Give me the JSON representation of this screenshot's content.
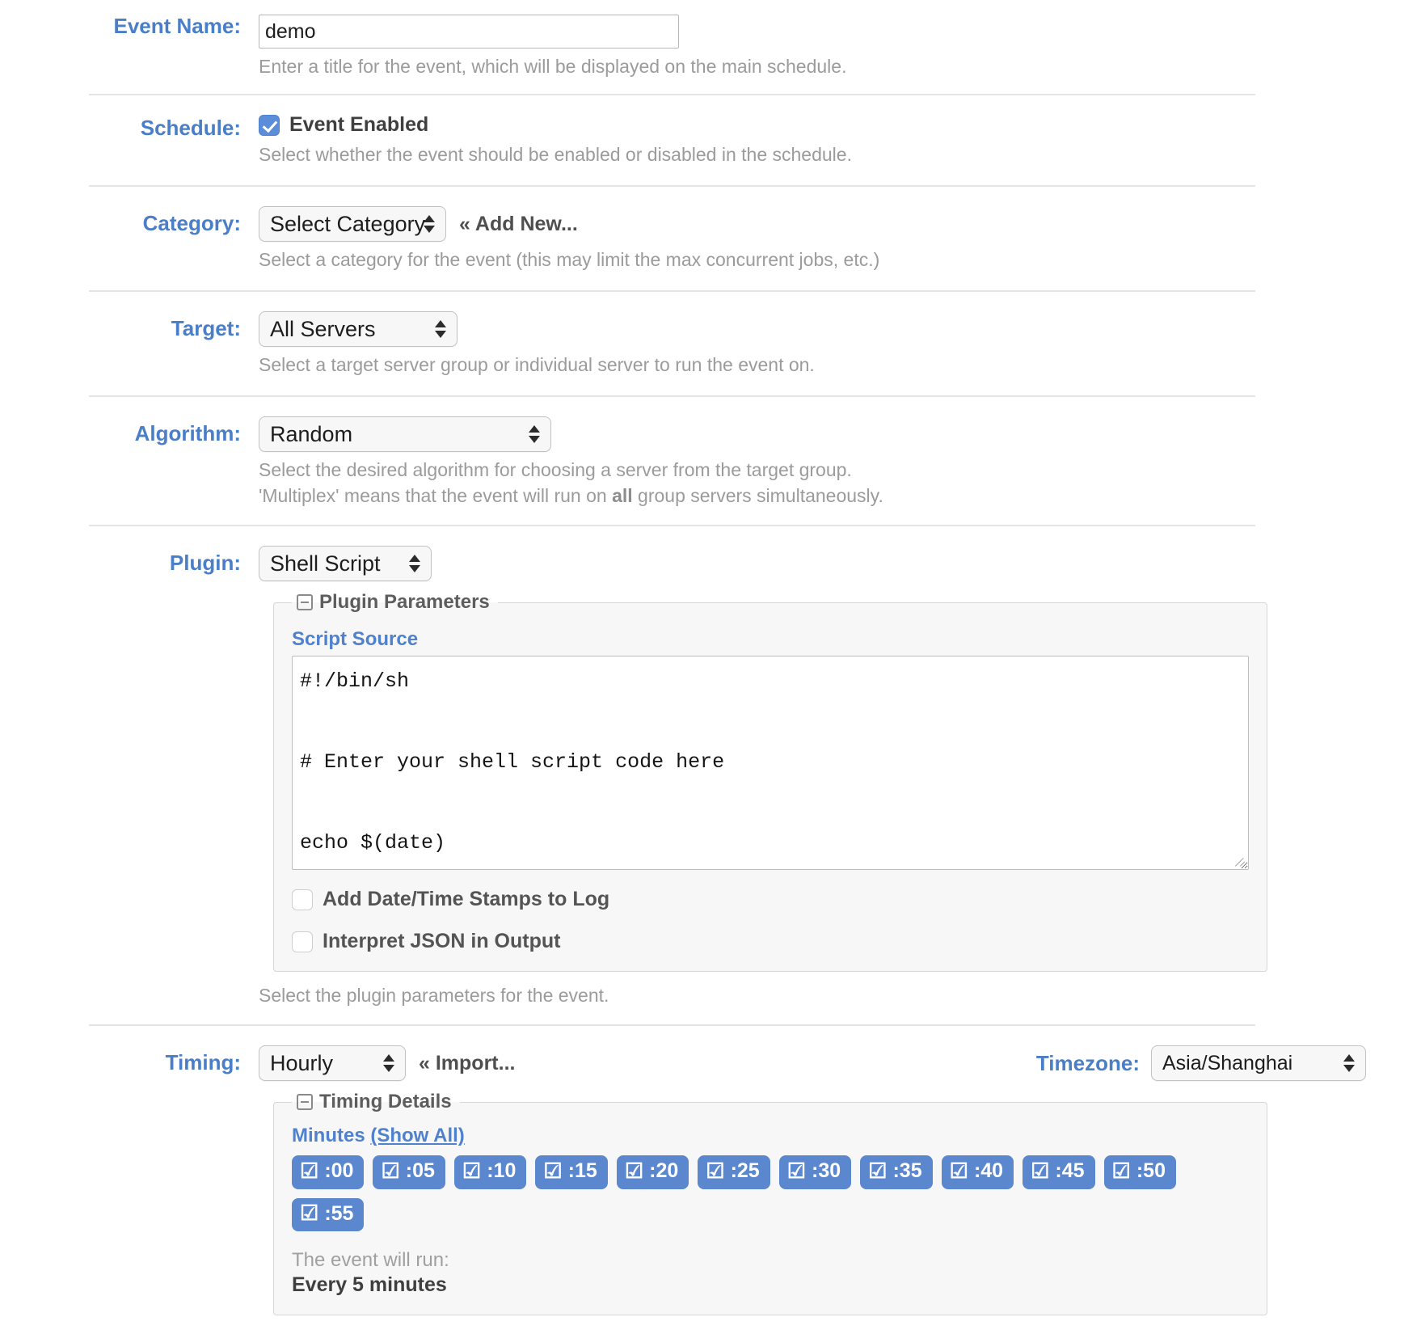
{
  "form": {
    "event_name": {
      "label": "Event Name:",
      "value": "demo",
      "placeholder": "",
      "hint": "Enter a title for the event, which will be displayed on the main schedule."
    },
    "schedule": {
      "label": "Schedule:",
      "checkbox_label": "Event Enabled",
      "checked": true,
      "hint": "Select whether the event should be enabled or disabled in the schedule."
    },
    "category": {
      "label": "Category:",
      "selected": "Select Category",
      "add_new_label": "« Add New...",
      "hint": "Select a category for the event (this may limit the max concurrent jobs, etc.)"
    },
    "target": {
      "label": "Target:",
      "selected": "All Servers",
      "hint": "Select a target server group or individual server to run the event on."
    },
    "algorithm": {
      "label": "Algorithm:",
      "selected": "Random",
      "hint_line1": "Select the desired algorithm for choosing a server from the target group.",
      "hint_line2_pre": "'Multiplex' means that the event will run on ",
      "hint_line2_bold": "all",
      "hint_line2_post": " group servers simultaneously."
    },
    "plugin": {
      "label": "Plugin:",
      "selected": "Shell Script",
      "fieldset_legend": "Plugin Parameters",
      "script_source_label": "Script Source",
      "script_source_value": "#!/bin/sh\n\n# Enter your shell script code here\n\necho $(date)",
      "checkboxes": [
        {
          "label": "Add Date/Time Stamps to Log",
          "checked": false
        },
        {
          "label": "Interpret JSON in Output",
          "checked": false
        }
      ],
      "hint": "Select the plugin parameters for the event."
    },
    "timing": {
      "label": "Timing:",
      "selected": "Hourly",
      "import_label": "« Import...",
      "timezone_label": "Timezone:",
      "timezone_selected": "Asia/Shanghai",
      "fieldset_legend": "Timing Details",
      "minutes_label": "Minutes",
      "show_all_label": "(Show All)",
      "minutes": [
        {
          "label": ":00",
          "checked": true
        },
        {
          "label": ":05",
          "checked": true
        },
        {
          "label": ":10",
          "checked": true
        },
        {
          "label": ":15",
          "checked": true
        },
        {
          "label": ":20",
          "checked": true
        },
        {
          "label": ":25",
          "checked": true
        },
        {
          "label": ":30",
          "checked": true
        },
        {
          "label": ":35",
          "checked": true
        },
        {
          "label": ":40",
          "checked": true
        },
        {
          "label": ":45",
          "checked": true
        },
        {
          "label": ":50",
          "checked": true
        },
        {
          "label": ":55",
          "checked": true
        }
      ],
      "will_run_label": "The event will run:",
      "will_run_value": "Every 5 minutes"
    }
  },
  "icons": {
    "checked_chip": "☑",
    "collapse": "collapse-icon",
    "select_arrows": "sort-arrows-icon"
  },
  "colors": {
    "label_blue": "#4a7ec6",
    "chip_blue": "#5b87cf",
    "hint_gray": "#9b9b9b",
    "checkbox_blue": "#5b8dd9"
  }
}
